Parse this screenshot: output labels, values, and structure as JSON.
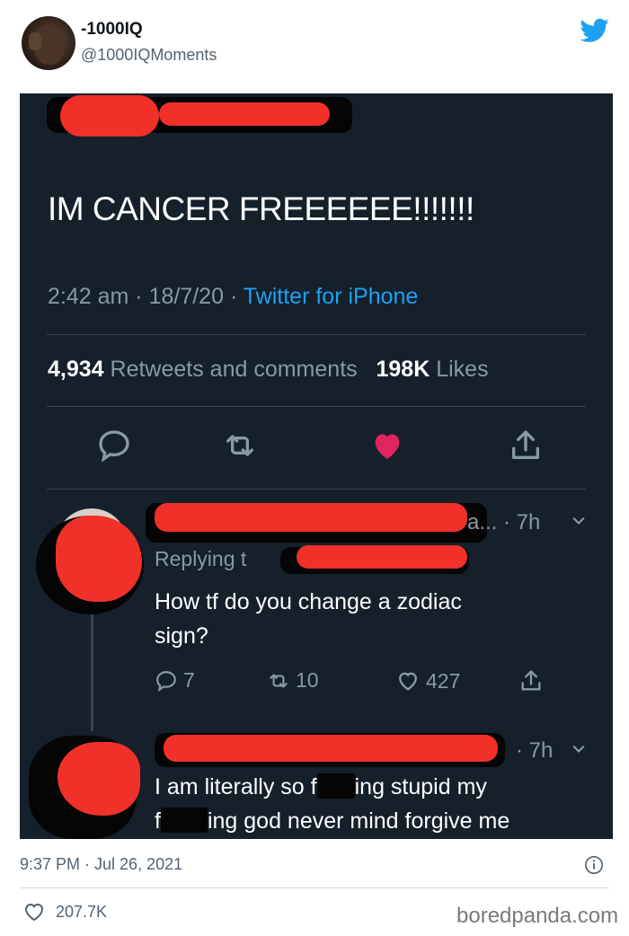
{
  "author": {
    "display_name": "-1000IQ",
    "handle": "@1000IQMoments"
  },
  "screenshot": {
    "tweet_text": "IM CANCER FREEEEEE!!!!!!!",
    "time": "2:42 am",
    "date": "18/7/20",
    "source": "Twitter for iPhone",
    "retweets_count": "4,934",
    "retweets_label": "Retweets and comments",
    "likes_count": "198K",
    "likes_label": "Likes",
    "reply1": {
      "meta": "a... · 7h",
      "replying_to": "Replying t",
      "text_line1": "How tf do you change a zodiac",
      "text_line2": "sign?",
      "replies": "7",
      "retweets": "10",
      "likes": "427"
    },
    "reply2": {
      "meta": "· 7h",
      "line1_a": "I am literally so f",
      "line1_b": "ing stupid my",
      "line2_a": "f",
      "line2_b": "ing god never mind forgive me"
    }
  },
  "footer": {
    "timestamp": "9:37 PM · Jul 26, 2021",
    "likes": "207.7K",
    "watermark": "boredpanda.com"
  },
  "colors": {
    "dark_bg": "#15202b",
    "redaction": "#f2302a",
    "like_heart": "#e0245e",
    "twitter_blue": "#1da1f2"
  }
}
